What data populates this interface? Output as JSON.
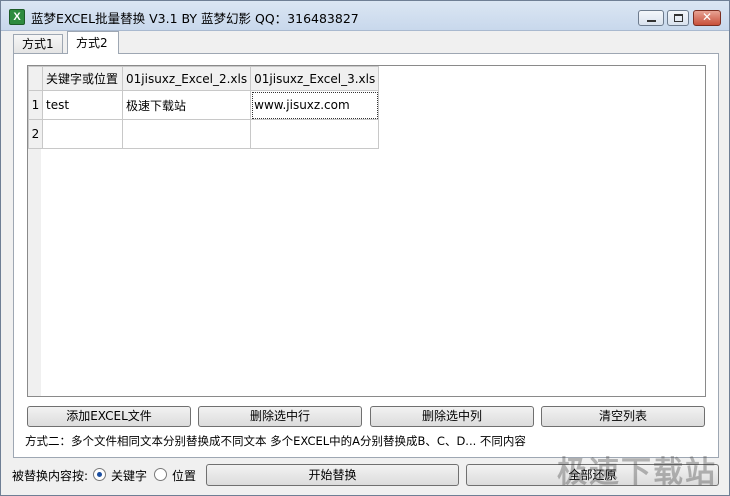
{
  "window": {
    "title": "蓝梦EXCEL批量替换 V3.1 BY 蓝梦幻影 QQ：316483827",
    "icon": "excel-app-icon"
  },
  "tabs": [
    {
      "label": "方式1",
      "active": false
    },
    {
      "label": "方式2",
      "active": true
    }
  ],
  "grid": {
    "columns": [
      "关键字或位置",
      "01jisuxz_Excel_2.xls",
      "01jisuxz_Excel_3.xls"
    ],
    "rows": [
      {
        "num": "1",
        "cells": [
          "test",
          "极速下载站",
          "www.jisuxz.com"
        ]
      },
      {
        "num": "2",
        "cells": [
          "",
          "",
          ""
        ]
      }
    ]
  },
  "buttons": {
    "add_excel": "添加EXCEL文件",
    "delete_row": "删除选中行",
    "delete_col": "删除选中列",
    "clear_list": "清空列表",
    "start": "开始替换",
    "all": "全部还原"
  },
  "note": "方式二：多个文件相同文本分别替换成不同文本  多个EXCEL中的A分别替换成B、C、D...  不同内容",
  "replace_by": {
    "label": "被替换内容按:",
    "options": [
      {
        "label": "关键字",
        "checked": true
      },
      {
        "label": "位置",
        "checked": false
      }
    ]
  },
  "watermark": "极速下载站"
}
